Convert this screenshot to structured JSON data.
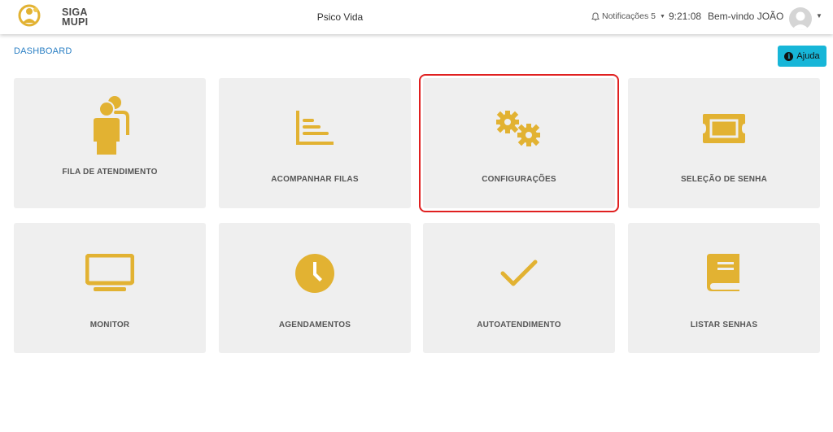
{
  "header": {
    "logo_line1": "SIGA",
    "logo_line2": "MUPI",
    "app_title": "Psico Vida",
    "notifications_label": "Notificações 5",
    "clock": "9:21:08",
    "welcome": "Bem-vindo JOÃO"
  },
  "breadcrumb": "DASHBOARD",
  "help_label": "Ajuda",
  "accent_color": "#e2b232",
  "cards": [
    {
      "label": "FILA DE ATENDIMENTO",
      "icon": "people-icon"
    },
    {
      "label": "ACOMPANHAR FILAS",
      "icon": "bar-chart-icon"
    },
    {
      "label": "CONFIGURAÇÕES",
      "icon": "gears-icon",
      "selected": true
    },
    {
      "label": "SELEÇÃO DE SENHA",
      "icon": "ticket-icon"
    },
    {
      "label": "MONITOR",
      "icon": "monitor-icon"
    },
    {
      "label": "AGENDAMENTOS",
      "icon": "clock-icon"
    },
    {
      "label": "AUTOATENDIMENTO",
      "icon": "checkmark-icon"
    },
    {
      "label": "LISTAR SENHAS",
      "icon": "book-icon"
    }
  ]
}
